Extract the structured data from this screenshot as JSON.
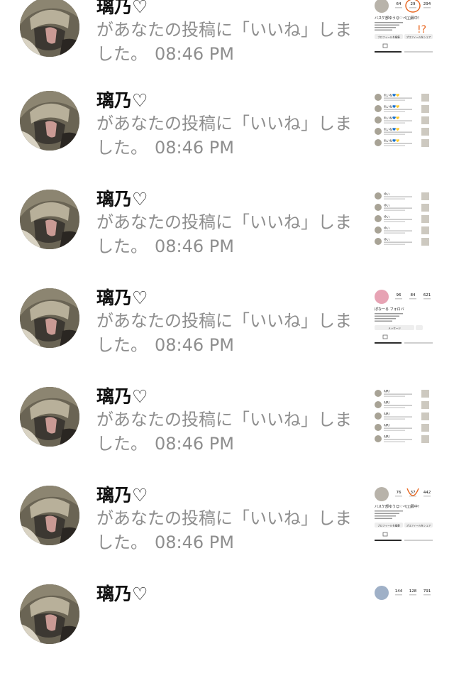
{
  "notifications": [
    {
      "user": "璃乃♡",
      "message": "があなたの投稿に「いいね」しま",
      "message_cont": "した。",
      "time": "08:46 PM",
      "thumb": {
        "kind": "profile",
        "stats": [
          "64",
          "29",
          "294"
        ],
        "bio": "バスケ部ゆう☺︎♡ペア⃣募中！",
        "buttons": [
          "プロフィールを編集",
          "プロフィールをシェア"
        ],
        "annotation": "!?"
      }
    },
    {
      "user": "璃乃♡",
      "message": "があなたの投稿に「いいね」しま",
      "message_cont": "した。",
      "time": "08:46 PM",
      "thumb": {
        "kind": "list",
        "name": "れいね💙💛"
      }
    },
    {
      "user": "璃乃♡",
      "message": "があなたの投稿に「いいね」しま",
      "message_cont": "した。",
      "time": "08:46 PM",
      "thumb": {
        "kind": "list",
        "name": "ゆい."
      }
    },
    {
      "user": "璃乃♡",
      "message": "があなたの投稿に「いいね」しま",
      "message_cont": "した。",
      "time": "08:46 PM",
      "thumb": {
        "kind": "profile2",
        "stats": [
          "96",
          "84",
          "621"
        ],
        "bio": "ぽなーる フォロバ",
        "buttons": [
          "メッセージ"
        ]
      }
    },
    {
      "user": "璃乃♡",
      "message": "があなたの投稿に「いいね」しま",
      "message_cont": "した。",
      "time": "08:46 PM",
      "thumb": {
        "kind": "list",
        "name": "AIRI"
      }
    },
    {
      "user": "璃乃♡",
      "message": "があなたの投稿に「いいね」しま",
      "message_cont": "した。",
      "time": "08:46 PM",
      "thumb": {
        "kind": "profile",
        "stats": [
          "76",
          "37",
          "442"
        ],
        "bio": "バスケ部ゆう☺︎♡ペア⃣募中！",
        "buttons": [
          "プロフィールを編集",
          "プロフィールをシェア"
        ],
        "annotation": ""
      }
    },
    {
      "user": "璃乃♡",
      "message": "",
      "message_cont": "",
      "time": "",
      "thumb": {
        "kind": "profile3",
        "stats": [
          "144",
          "128",
          "791"
        ]
      }
    }
  ],
  "colors": {
    "text": "#111111",
    "subtext": "#8e8e8e",
    "annotation": "#e8641c",
    "background": "#ffffff"
  },
  "icons": {
    "avatar": "user-photo-avatar",
    "thumbnail": "post-thumbnail"
  }
}
